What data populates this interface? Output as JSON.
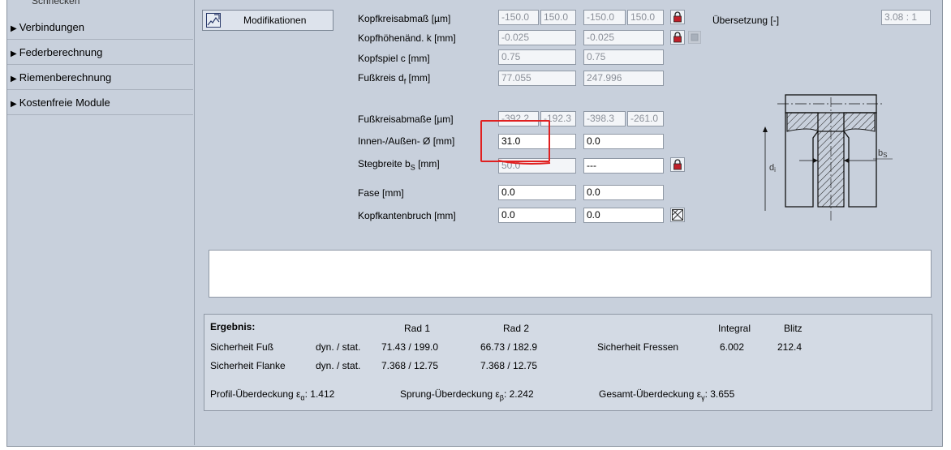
{
  "sidebar": {
    "partial_item": "Schnecken",
    "items": [
      {
        "label": "Verbindungen"
      },
      {
        "label": "Federberechnung"
      },
      {
        "label": "Riemenberechnung"
      },
      {
        "label": "Kostenfreie Module"
      }
    ]
  },
  "toolbar": {
    "modifications_label": "Modifikationen"
  },
  "fields": {
    "kopfkreisabmass": {
      "label": "Kopfkreisabmaß [µm]",
      "r1a": "-150.0",
      "r1b": "150.0",
      "r2a": "-150.0",
      "r2b": "150.0"
    },
    "kopfhoehenaend": {
      "label": "Kopfhöhenänd. k [mm]",
      "r1": "-0.025",
      "r2": "-0.025"
    },
    "kopfspiel": {
      "label": "Kopfspiel c [mm]",
      "r1": "0.75",
      "r2": "0.75"
    },
    "fusskreis": {
      "label_main": "Fußkreis d",
      "label_sub": "f",
      "label_unit": " [mm]",
      "r1": "77.055",
      "r2": "247.996"
    },
    "fusskreisabmasse": {
      "label": "Fußkreisabmaße [µm]",
      "r1a": "-392.2",
      "r1b": "-192.3",
      "r2a": "-398.3",
      "r2b": "-261.0"
    },
    "innen_aussen": {
      "label": "Innen-/Außen- Ø [mm]",
      "r1": "31.0",
      "r2": "0.0"
    },
    "stegbreite": {
      "label_main": "Stegbreite b",
      "label_sub": "S",
      "label_unit": " [mm]",
      "r1": "50.0",
      "r2": "---"
    },
    "fase": {
      "label": "Fase [mm]",
      "r1": "0.0",
      "r2": "0.0"
    },
    "kopfkantenbruch": {
      "label": "Kopfkantenbruch [mm]",
      "r1": "0.0",
      "r2": "0.0"
    }
  },
  "ratio": {
    "label": "Übersetzung [-]",
    "value": "3.08 : 1"
  },
  "diagram": {
    "label_di": "d",
    "label_di_sub": "i",
    "label_bs": "b",
    "label_bs_sub": "S"
  },
  "result": {
    "title": "Ergebnis:",
    "col_rad1": "Rad 1",
    "col_rad2": "Rad 2",
    "col_integral": "Integral",
    "col_blitz": "Blitz",
    "row1_label": "Sicherheit Fuß",
    "row1_type": "dyn. / stat.",
    "row1_r1": "71.43  / 199.0",
    "row1_r2": "66.73  / 182.9",
    "fressen_label": "Sicherheit Fressen",
    "fressen_integral": "6.002",
    "fressen_blitz": "212.4",
    "row2_label": "Sicherheit Flanke",
    "row2_type": "dyn. / stat.",
    "row2_r1": "7.368  / 12.75",
    "row2_r2": "7.368  / 12.75",
    "profil_label": "Profil-Überdeckung ε",
    "profil_sub": "α",
    "profil_value": ": 1.412",
    "sprung_label": "Sprung-Überdeckung ε",
    "sprung_sub": "β",
    "sprung_value": ": 2.242",
    "gesamt_label": "Gesamt-Überdeckung ε",
    "gesamt_sub": "γ",
    "gesamt_value": ": 3.655"
  }
}
